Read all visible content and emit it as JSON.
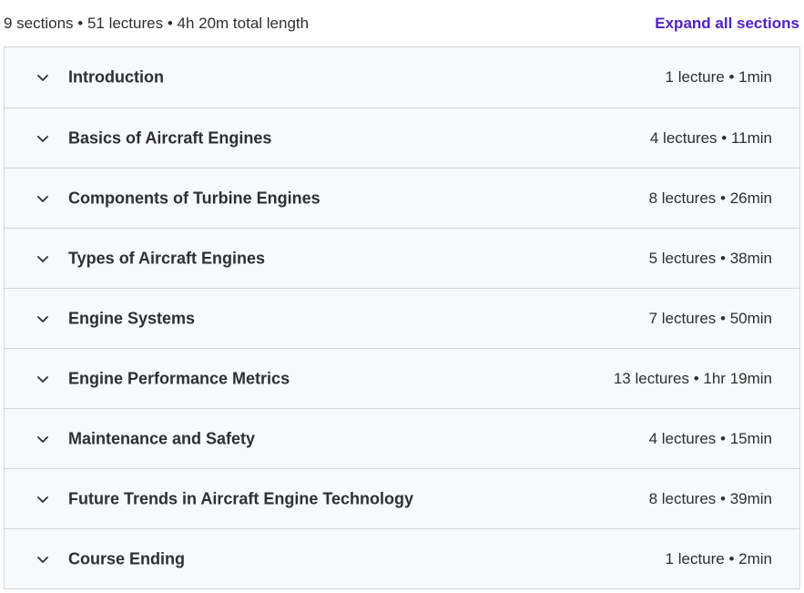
{
  "summary": {
    "text": "9 sections • 51 lectures • 4h 20m total length",
    "expand_label": "Expand all sections"
  },
  "colors": {
    "link": "#5022c3",
    "row_background": "#f7f9fa",
    "border": "#d1d7dc",
    "text": "#2d2f31"
  },
  "sections": [
    {
      "title": "Introduction",
      "meta": "1 lecture • 1min",
      "icon": "chevron-down-icon"
    },
    {
      "title": "Basics of Aircraft Engines",
      "meta": "4 lectures • 11min",
      "icon": "chevron-down-icon"
    },
    {
      "title": "Components of Turbine Engines",
      "meta": "8 lectures • 26min",
      "icon": "chevron-down-icon"
    },
    {
      "title": "Types of Aircraft Engines",
      "meta": "5 lectures • 38min",
      "icon": "chevron-down-icon"
    },
    {
      "title": "Engine Systems",
      "meta": "7 lectures • 50min",
      "icon": "chevron-down-icon"
    },
    {
      "title": "Engine Performance Metrics",
      "meta": "13 lectures • 1hr 19min",
      "icon": "chevron-down-icon"
    },
    {
      "title": "Maintenance and Safety",
      "meta": "4 lectures • 15min",
      "icon": "chevron-down-icon"
    },
    {
      "title": "Future Trends in Aircraft Engine Technology",
      "meta": "8 lectures • 39min",
      "icon": "chevron-down-icon"
    },
    {
      "title": "Course Ending",
      "meta": "1 lecture • 2min",
      "icon": "chevron-down-icon"
    }
  ]
}
